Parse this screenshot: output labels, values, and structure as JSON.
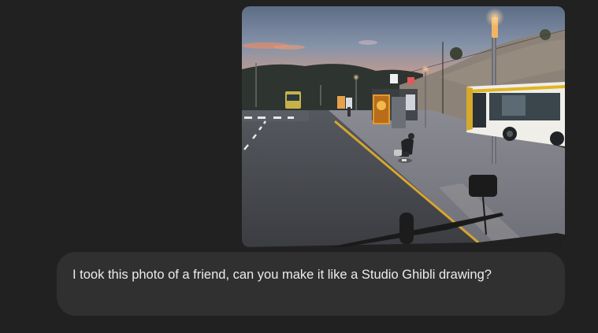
{
  "conversation": {
    "messages": [
      {
        "role": "user",
        "attachment": {
          "kind": "image",
          "description": "Photo taken from inside a bus windshield at dusk: a road with a bus stop, streetlights, shelter, a crouching person and a parked bus on the right"
        },
        "text": "I took this photo of a friend, can you make it like a Studio Ghibli drawing?"
      }
    ]
  },
  "colors": {
    "page_background": "#212121",
    "bubble_background": "#303030",
    "bubble_text": "#ececec"
  }
}
